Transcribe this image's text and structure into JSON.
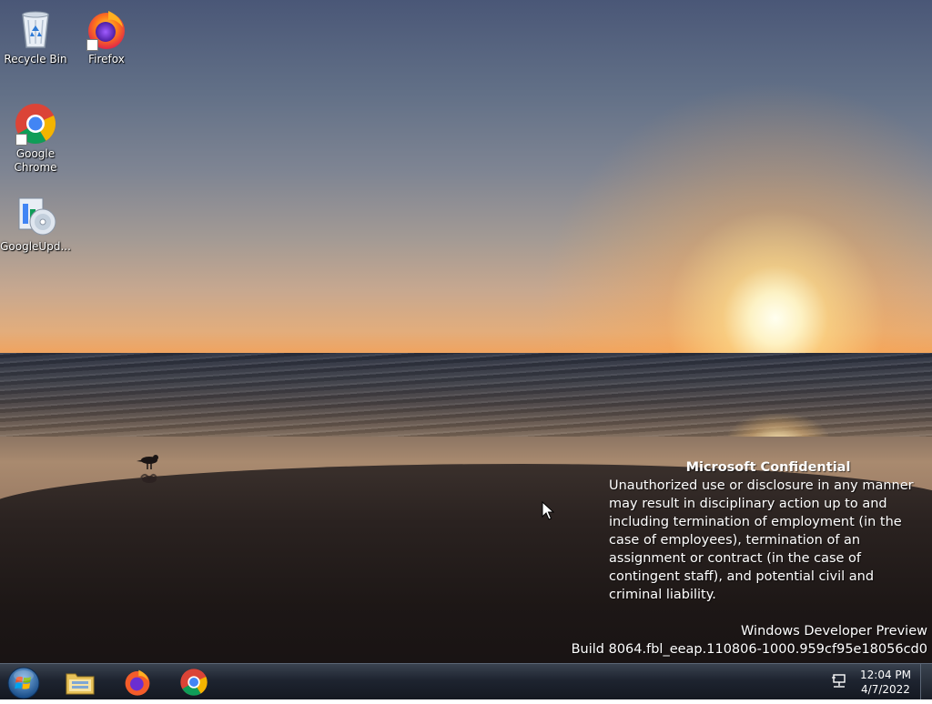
{
  "desktop": {
    "icons": [
      {
        "label": "Recycle Bin",
        "icon": "recycle-bin-icon"
      },
      {
        "label": "Firefox",
        "icon": "firefox-icon"
      },
      {
        "label": "Google Chrome",
        "icon": "chrome-icon"
      },
      {
        "label": "GoogleUpd...",
        "icon": "google-update-icon"
      }
    ]
  },
  "watermark": {
    "title": "Microsoft Confidential",
    "body": "Unauthorized use or disclosure in any manner may result in disciplinary action up to and including termination of employment (in the case of employees), termination of an assignment or contract (in the case of contingent staff), and potential civil and criminal liability.",
    "edition": "Windows Developer Preview",
    "build": "Build 8064.fbl_eeap.110806-1000.959cf95e18056cd0"
  },
  "taskbar": {
    "start_icon": "windows-start-orb-icon",
    "pinned": [
      {
        "name": "file-explorer",
        "icon": "folder-explorer-icon"
      },
      {
        "name": "firefox",
        "icon": "firefox-icon"
      },
      {
        "name": "chrome",
        "icon": "chrome-icon"
      }
    ],
    "tray": {
      "network_icon": "network-icon",
      "time": "12:04 PM",
      "date": "4/7/2022"
    }
  },
  "colors": {
    "taskbar": "#1e2430",
    "sky_top": "#4a5777",
    "sun": "#fff6c8"
  }
}
